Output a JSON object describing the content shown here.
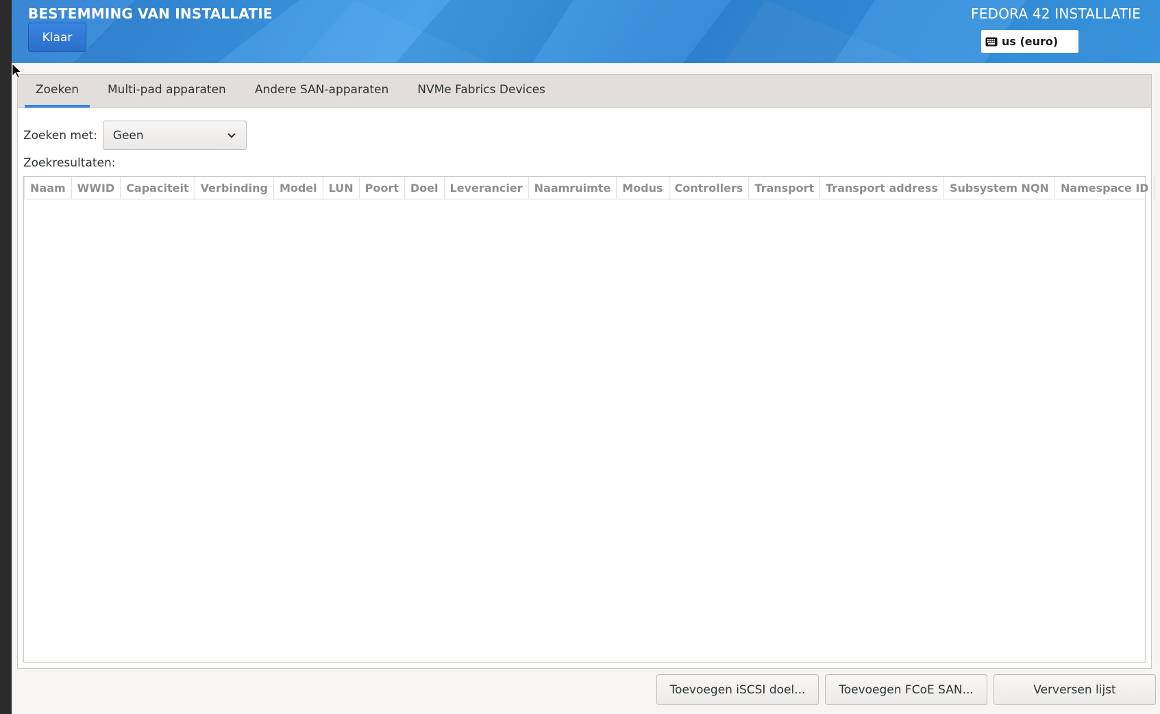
{
  "header": {
    "title": "BESTEMMING VAN INSTALLATIE",
    "product": "FEDORA 42 INSTALLATIE",
    "done_label": "Klaar",
    "keyboard_layout": "us (euro)"
  },
  "tabs": [
    {
      "label": "Zoeken",
      "active": true
    },
    {
      "label": "Multi-pad apparaten",
      "active": false
    },
    {
      "label": "Andere SAN-apparaten",
      "active": false
    },
    {
      "label": "NVMe Fabrics Devices",
      "active": false
    }
  ],
  "search": {
    "label": "Zoeken met:",
    "selected": "Geen"
  },
  "results": {
    "label": "Zoekresultaten:",
    "columns": [
      "Naam",
      "WWID",
      "Capaciteit",
      "Verbinding",
      "Model",
      "LUN",
      "Poort",
      "Doel",
      "Leverancier",
      "Naamruimte",
      "Modus",
      "Controllers",
      "Transport",
      "Transport address",
      "Subsystem NQN",
      "Namespace ID"
    ],
    "rows": []
  },
  "actions": {
    "add_iscsi": "Toevoegen iSCSI doel...",
    "add_fcoe": "Toevoegen FCoE SAN...",
    "refresh": "Verversen lijst"
  },
  "colors": {
    "accent": "#3584e4",
    "header_blue": "#3a94e2"
  }
}
